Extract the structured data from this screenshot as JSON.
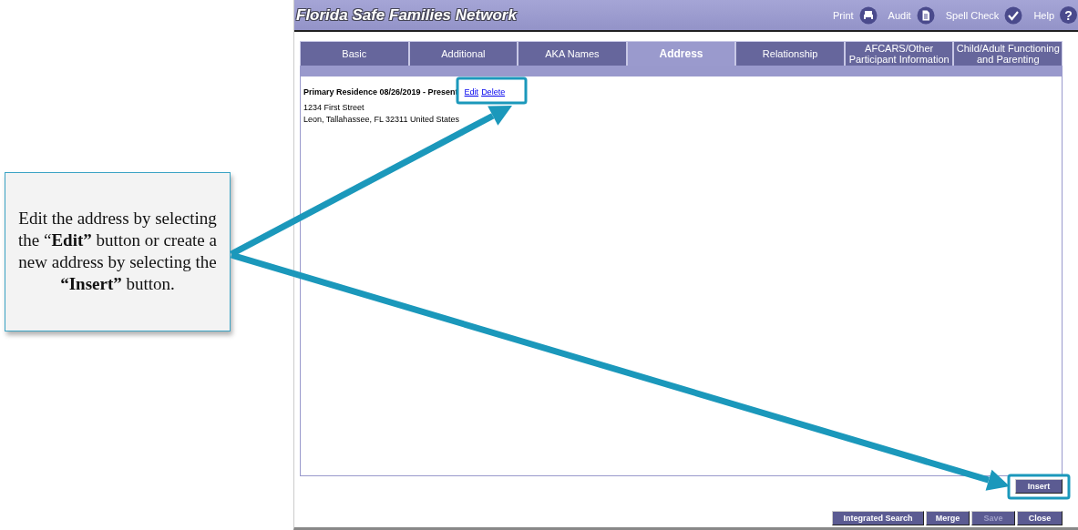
{
  "callout": {
    "text": "Edit the address by selecting the “**Edit”** button or create a new address by selecting the **“Insert”** button."
  },
  "title_bar": {
    "title": "Florida Safe Families Network",
    "actions": [
      {
        "label": "Print",
        "kind": "printer"
      },
      {
        "label": "Audit",
        "kind": "document"
      },
      {
        "label": "Spell Check",
        "kind": "spellcheck"
      },
      {
        "label": "Help",
        "kind": "help",
        "glyph": "?"
      }
    ]
  },
  "tabs": [
    {
      "label": "Basic",
      "selected": false
    },
    {
      "label": "Additional",
      "selected": false
    },
    {
      "label": "AKA Names",
      "selected": false
    },
    {
      "label": "Address",
      "selected": true
    },
    {
      "label": "Relationship",
      "selected": false
    },
    {
      "label": "AFCARS/Other Participant Information",
      "selected": false
    },
    {
      "label": "Child/Adult Functioning and Parenting",
      "selected": false
    }
  ],
  "address": {
    "heading": "Primary Residence 08/26/2019 - Present",
    "links": [
      "Edit",
      "Delete"
    ],
    "lines": [
      "1234 First Street",
      "Leon, Tallahassee, FL 32311 United States"
    ]
  },
  "insert_button": {
    "label": "Insert"
  },
  "footer_buttons": [
    {
      "label": "Integrated Search",
      "disabled": false
    },
    {
      "label": "Merge",
      "disabled": false
    },
    {
      "label": "Save",
      "disabled": true
    },
    {
      "label": "Close",
      "disabled": false
    }
  ]
}
